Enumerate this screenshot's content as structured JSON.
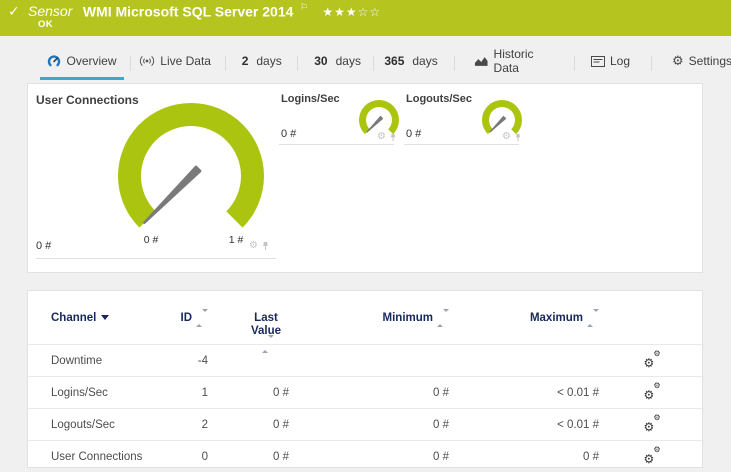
{
  "header": {
    "check": "✓",
    "kind": "Sensor",
    "title": "WMI Microsoft SQL Server 2014",
    "flag": "⚐",
    "stars": "★★★☆☆",
    "status": "OK"
  },
  "tabs": {
    "overview": "Overview",
    "live": "Live Data",
    "d2_num": "2",
    "d2_unit": "days",
    "d30_num": "30",
    "d30_unit": "days",
    "d365_num": "365",
    "d365_unit": "days",
    "historic": "Historic Data",
    "log": "Log",
    "settings": "Settings"
  },
  "gauges": {
    "primary": {
      "title": "User Connections",
      "value": "0 #",
      "scale_min": "0 #",
      "scale_max": "1 #"
    },
    "logins": {
      "title": "Logins/Sec",
      "value": "0 #"
    },
    "logouts": {
      "title": "Logouts/Sec",
      "value": "0 #"
    }
  },
  "table": {
    "headers": {
      "channel": "Channel",
      "id": "ID",
      "last": "Last Value",
      "min": "Minimum",
      "max": "Maximum"
    },
    "rows": [
      {
        "channel": "Downtime",
        "id": "-4",
        "last": "",
        "min": "",
        "max": ""
      },
      {
        "channel": "Logins/Sec",
        "id": "1",
        "last": "0 #",
        "min": "0 #",
        "max": "< 0.01 #"
      },
      {
        "channel": "Logouts/Sec",
        "id": "2",
        "last": "0 #",
        "min": "0 #",
        "max": "< 0.01 #"
      },
      {
        "channel": "User Connections",
        "id": "0",
        "last": "0 #",
        "min": "0 #",
        "max": "0 #"
      }
    ]
  },
  "colors": {
    "header_green": "#b5c41e",
    "gauge_green": "#abc40f",
    "needle_gray": "#7a7a7a",
    "accent_blue": "#36a8da",
    "table_header_navy": "#17285c"
  }
}
